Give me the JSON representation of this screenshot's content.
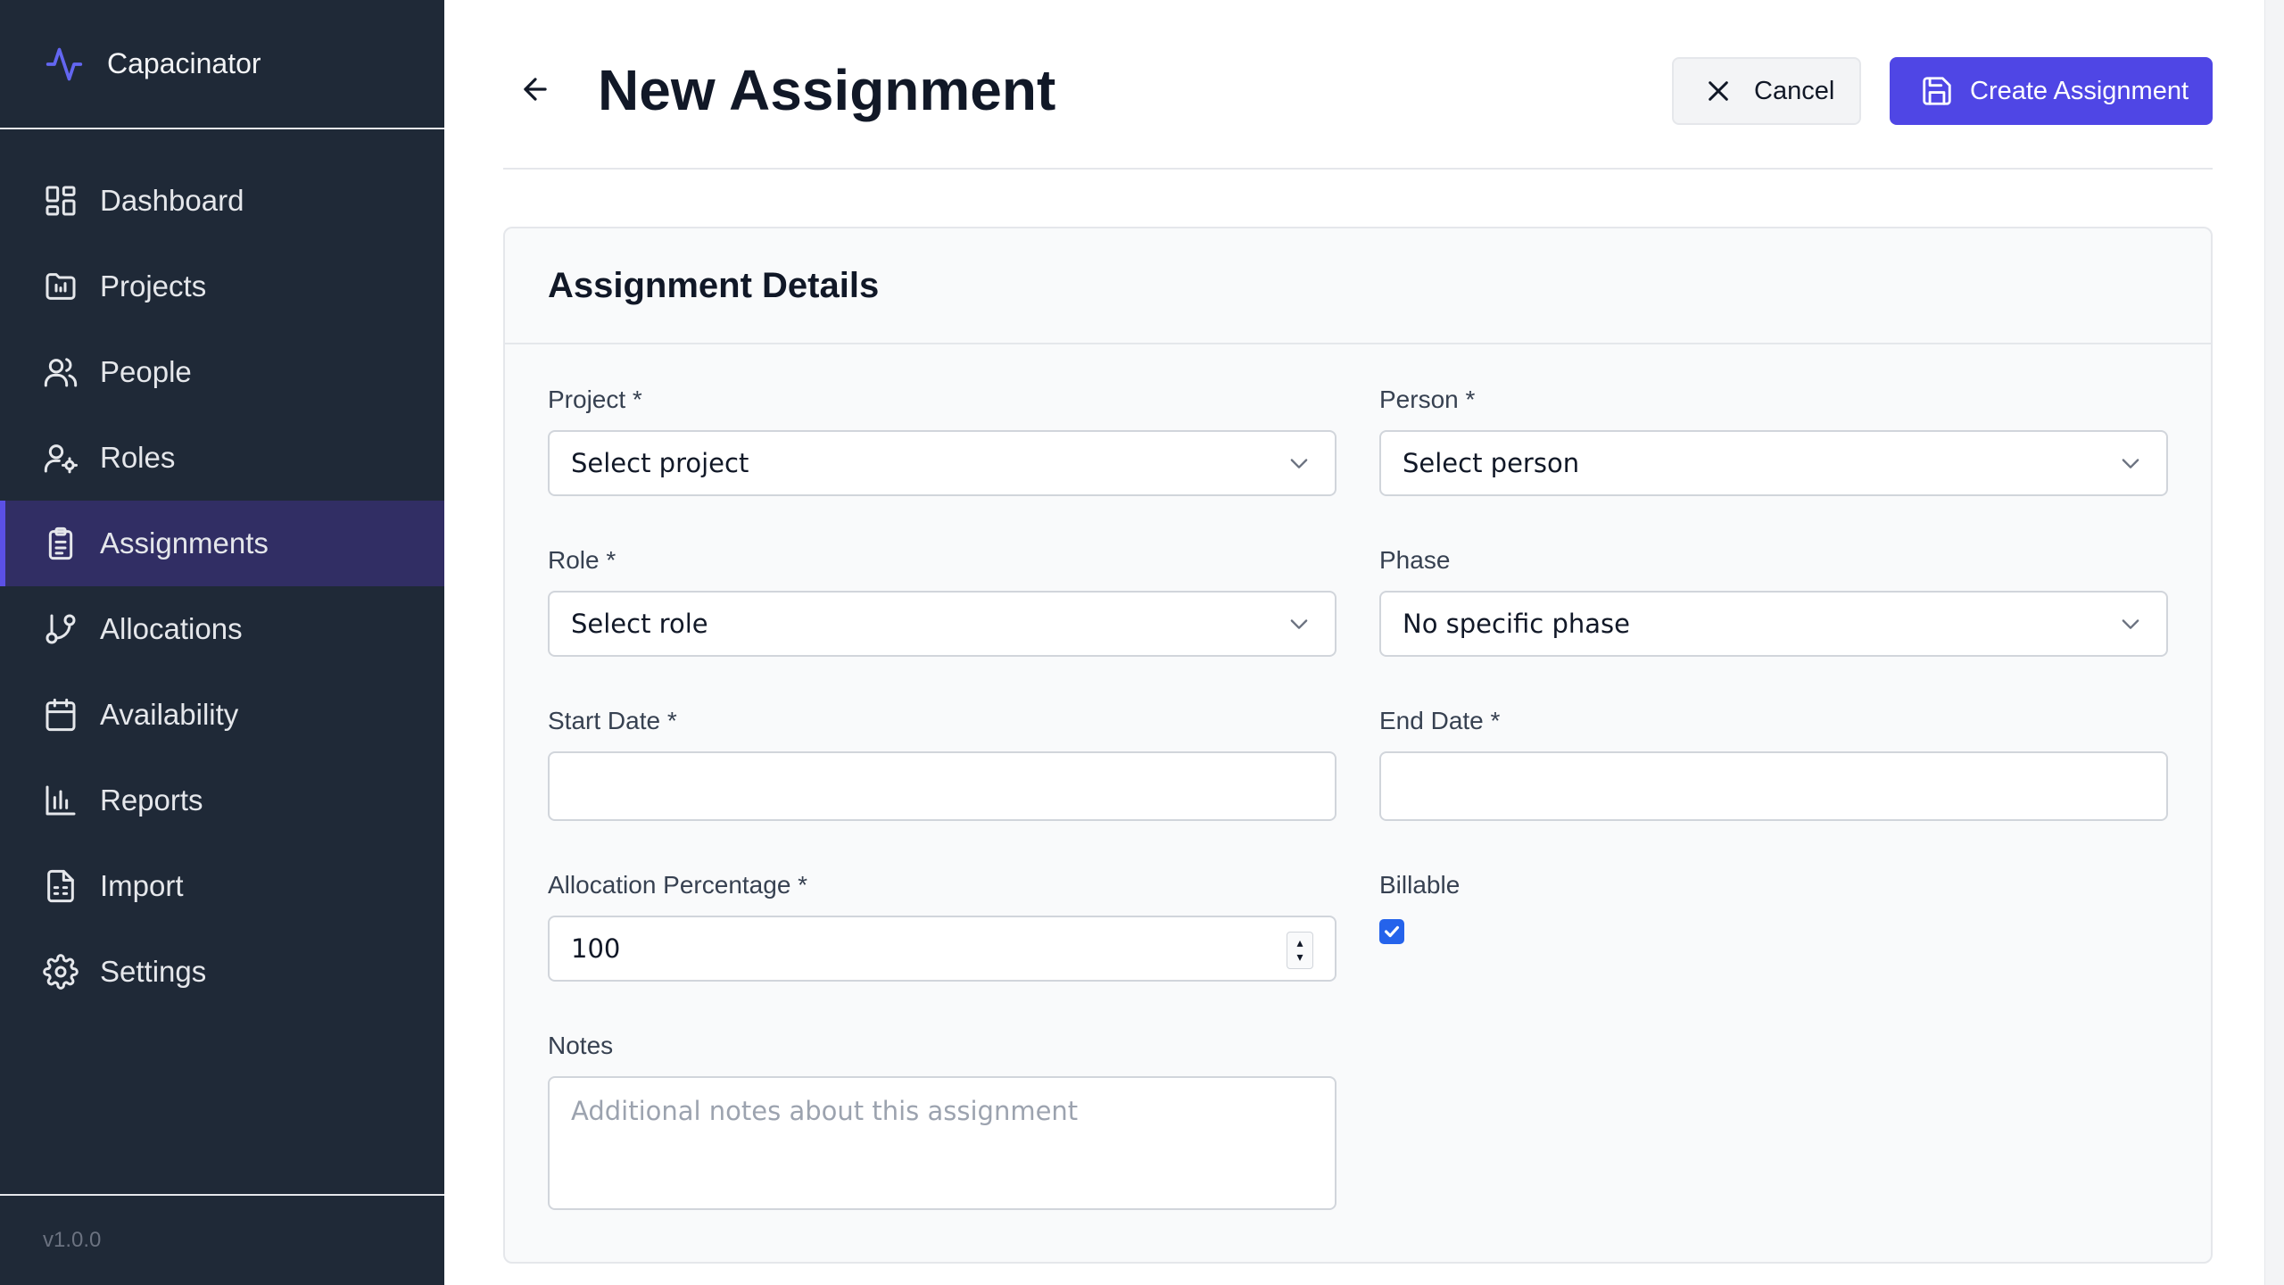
{
  "app": {
    "name": "Capacinator",
    "version": "v1.0.0"
  },
  "sidebar": {
    "items": [
      {
        "label": "Dashboard",
        "icon": "dashboard-icon"
      },
      {
        "label": "Projects",
        "icon": "folder-chart-icon"
      },
      {
        "label": "People",
        "icon": "users-icon"
      },
      {
        "label": "Roles",
        "icon": "user-cog-icon"
      },
      {
        "label": "Assignments",
        "icon": "clipboard-list-icon",
        "active": true
      },
      {
        "label": "Allocations",
        "icon": "git-branch-icon"
      },
      {
        "label": "Availability",
        "icon": "calendar-icon"
      },
      {
        "label": "Reports",
        "icon": "bar-chart-icon"
      },
      {
        "label": "Import",
        "icon": "file-spreadsheet-icon"
      },
      {
        "label": "Settings",
        "icon": "gear-icon"
      }
    ]
  },
  "header": {
    "title": "New Assignment",
    "cancel_label": "Cancel",
    "create_label": "Create Assignment"
  },
  "form": {
    "section_title": "Assignment Details",
    "project": {
      "label": "Project *",
      "value": "Select project"
    },
    "person": {
      "label": "Person *",
      "value": "Select person"
    },
    "role": {
      "label": "Role *",
      "value": "Select role"
    },
    "phase": {
      "label": "Phase",
      "value": "No specific phase"
    },
    "start_date": {
      "label": "Start Date *",
      "value": ""
    },
    "end_date": {
      "label": "End Date *",
      "value": ""
    },
    "allocation": {
      "label": "Allocation Percentage *",
      "value": "100"
    },
    "billable": {
      "label": "Billable",
      "checked": true
    },
    "notes": {
      "label": "Notes",
      "placeholder": "Additional notes about this assignment"
    }
  },
  "colors": {
    "sidebar_bg": "#1f2937",
    "accent": "#4f46e5",
    "active_bg": "#312e64",
    "checkbox": "#2563eb"
  }
}
